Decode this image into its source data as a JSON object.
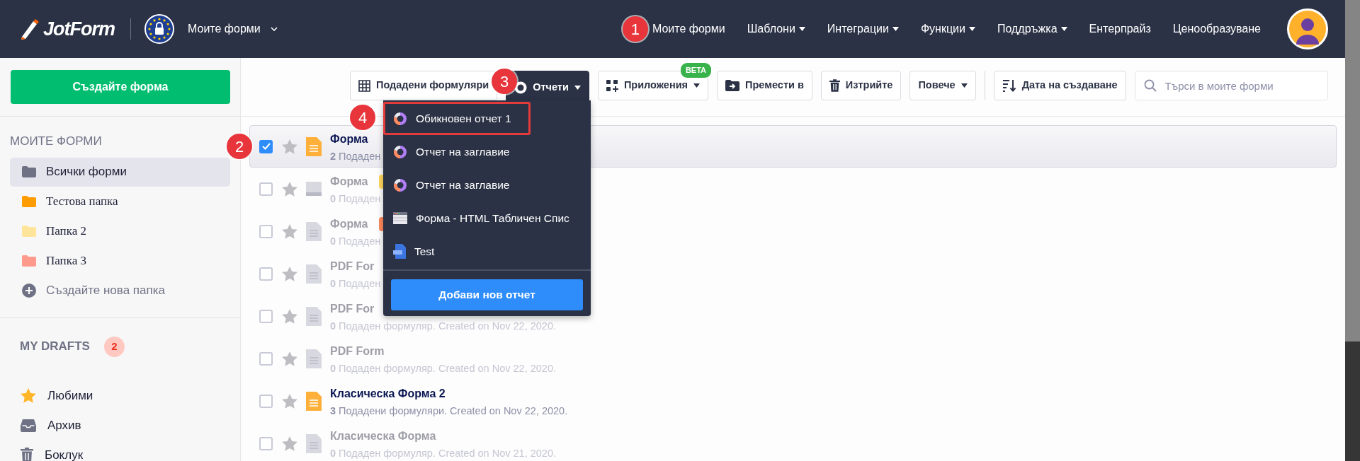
{
  "header": {
    "logo": "JotForm",
    "workspace": {
      "label": "Моите форми",
      "expanded": false
    },
    "callout": "1",
    "nav": [
      {
        "label": "Моите форми",
        "has_menu": false
      },
      {
        "label": "Шаблони",
        "has_menu": true
      },
      {
        "label": "Интеграции",
        "has_menu": true
      },
      {
        "label": "Функции",
        "has_menu": true
      },
      {
        "label": "Поддръжка",
        "has_menu": true
      },
      {
        "label": "Ентерпрайз",
        "has_menu": false
      },
      {
        "label": "Ценообразуване",
        "has_menu": false
      }
    ]
  },
  "sidebar": {
    "create_button": "Създайте форма",
    "section_title": "МОИТЕ ФОРМИ",
    "folders": [
      {
        "label": "Всички форми",
        "kind": "all",
        "selected": true,
        "color": "#6f7285"
      },
      {
        "label": "Тестова папка",
        "kind": "folder",
        "selected": false,
        "color": "#ff9c00"
      },
      {
        "label": "Папка 2",
        "kind": "folder",
        "selected": false,
        "color": "#ffe59b"
      },
      {
        "label": "Папка 3",
        "kind": "folder",
        "selected": false,
        "color": "#ff9a8c"
      },
      {
        "label": "Създайте нова папка",
        "kind": "add",
        "selected": false
      }
    ],
    "drafts": {
      "title": "MY DRAFTS",
      "count": "2"
    },
    "links": [
      {
        "label": "Любими",
        "kind": "favorites"
      },
      {
        "label": "Архив",
        "kind": "archive"
      },
      {
        "label": "Боклук",
        "kind": "trash"
      }
    ]
  },
  "toolbar": {
    "buttons": [
      {
        "label": "Подадени формуляри",
        "kind": "submissions",
        "has_menu": false,
        "expanded": false
      },
      {
        "label": "Отчети",
        "kind": "reports",
        "has_menu": true,
        "expanded": true,
        "callout": "3"
      },
      {
        "label": "Приложения",
        "kind": "apps",
        "has_menu": true,
        "expanded": false,
        "badge": "BETA"
      },
      {
        "label": "Премести в",
        "kind": "move",
        "has_menu": false,
        "expanded": false
      },
      {
        "label": "Изтрийте",
        "kind": "delete",
        "has_menu": false,
        "expanded": false
      },
      {
        "label": "Повече",
        "kind": "more",
        "has_menu": true,
        "expanded": false
      }
    ],
    "sort_button": "Дата на създаване",
    "search": {
      "placeholder": "Търси в моите форми"
    }
  },
  "reports_menu": {
    "items": [
      {
        "label": "Обикновен отчет 1",
        "kind": "report",
        "highlighted": true,
        "callout": "4"
      },
      {
        "label": "Отчет на заглавие",
        "kind": "report",
        "highlighted": false
      },
      {
        "label": "Отчет на заглавие",
        "kind": "report",
        "highlighted": false
      },
      {
        "label": "Форма - HTML Табличен Спис",
        "kind": "table",
        "highlighted": false
      },
      {
        "label": "Test",
        "kind": "pdf",
        "highlighted": false
      }
    ],
    "add_button": "Добави нов отчет"
  },
  "forms": [
    {
      "title": "Форма",
      "count": "2",
      "subtitle": "Подаден",
      "selected": true,
      "enabled": true,
      "kind": "doc",
      "callout": "2"
    },
    {
      "title": "Форма",
      "count": "0",
      "subtitle": "Подаден",
      "selected": false,
      "enabled": false,
      "kind": "card",
      "color": "#ffd75e"
    },
    {
      "title": "Форма",
      "count": "0",
      "subtitle": "Подаден",
      "selected": false,
      "enabled": false,
      "kind": "doc",
      "color": "#ff8a5c"
    },
    {
      "title": "PDF For",
      "count": "0",
      "subtitle": "Подаден",
      "selected": false,
      "enabled": false,
      "kind": "doc"
    },
    {
      "title": "PDF For",
      "count": "0",
      "subtitle": "Подаден формуляр. Created on Nov 22, 2020.",
      "selected": false,
      "enabled": false,
      "kind": "doc"
    },
    {
      "title": "PDF Form",
      "count": "0",
      "subtitle": "Подаден формуляр. Created on Nov 22, 2020.",
      "selected": false,
      "enabled": false,
      "kind": "doc"
    },
    {
      "title": "Класическа Форма 2",
      "count": "3",
      "subtitle": "Подадени формуляри. Created on Nov 22, 2020.",
      "selected": false,
      "enabled": true,
      "kind": "doc"
    },
    {
      "title": "Класическа Форма",
      "count": "0",
      "subtitle": "Подаден формуляр. Created on Nov 21, 2020.",
      "selected": false,
      "enabled": false,
      "kind": "doc"
    }
  ]
}
